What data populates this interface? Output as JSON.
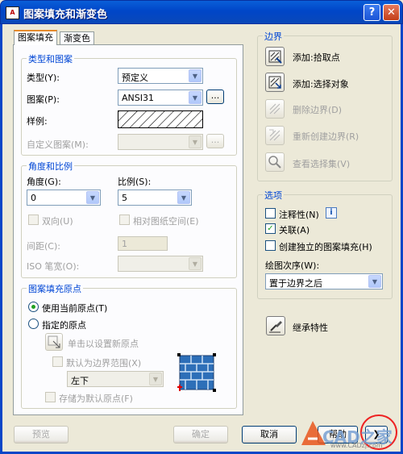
{
  "window": {
    "title": "图案填充和渐变色",
    "app_icon": "AutoCAD"
  },
  "tabs": [
    {
      "label": "图案填充"
    },
    {
      "label": "渐变色"
    }
  ],
  "type_pattern": {
    "group_label": "类型和图案",
    "type_label": "类型(Y):",
    "type_value": "预定义",
    "pattern_label": "图案(P):",
    "pattern_value": "ANSI31",
    "swatch_label": "样例:",
    "custom_label": "自定义图案(M):",
    "custom_value": "",
    "dots": "..."
  },
  "angle_scale": {
    "group_label": "角度和比例",
    "angle_label": "角度(G):",
    "angle_value": "0",
    "scale_label": "比例(S):",
    "scale_value": "5",
    "double_label": "双向(U)",
    "relative_label": "相对图纸空间(E)",
    "spacing_label": "间距(C):",
    "spacing_value": "1",
    "iso_label": "ISO 笔宽(O):",
    "iso_value": ""
  },
  "origin": {
    "group_label": "图案填充原点",
    "use_current_label": "使用当前原点(T)",
    "specified_label": "指定的原点",
    "click_set_label": "单击以设置新原点",
    "default_extents_label": "默认为边界范围(X)",
    "extents_value": "左下",
    "store_default_label": "存储为默认原点(F)"
  },
  "boundaries": {
    "group_label": "边界",
    "add_pick_points": "添加:拾取点",
    "add_select_objects": "添加:选择对象",
    "remove_boundaries": "删除边界(D)",
    "recreate_boundary": "重新创建边界(R)",
    "view_selections": "查看选择集(V)"
  },
  "options": {
    "group_label": "选项",
    "annotative_label": "注释性(N)",
    "associative_label": "关联(A)",
    "associative_checked": true,
    "separate_label": "创建独立的图案填充(H)",
    "draw_order_label": "绘图次序(W):",
    "draw_order_value": "置于边界之后"
  },
  "inherit_label": "继承特性",
  "footer": {
    "preview": "预览",
    "ok": "确定",
    "cancel": "取消",
    "help": "帮助"
  },
  "watermark": {
    "text": "CAD之家",
    "url": "www.CADzj.com"
  }
}
